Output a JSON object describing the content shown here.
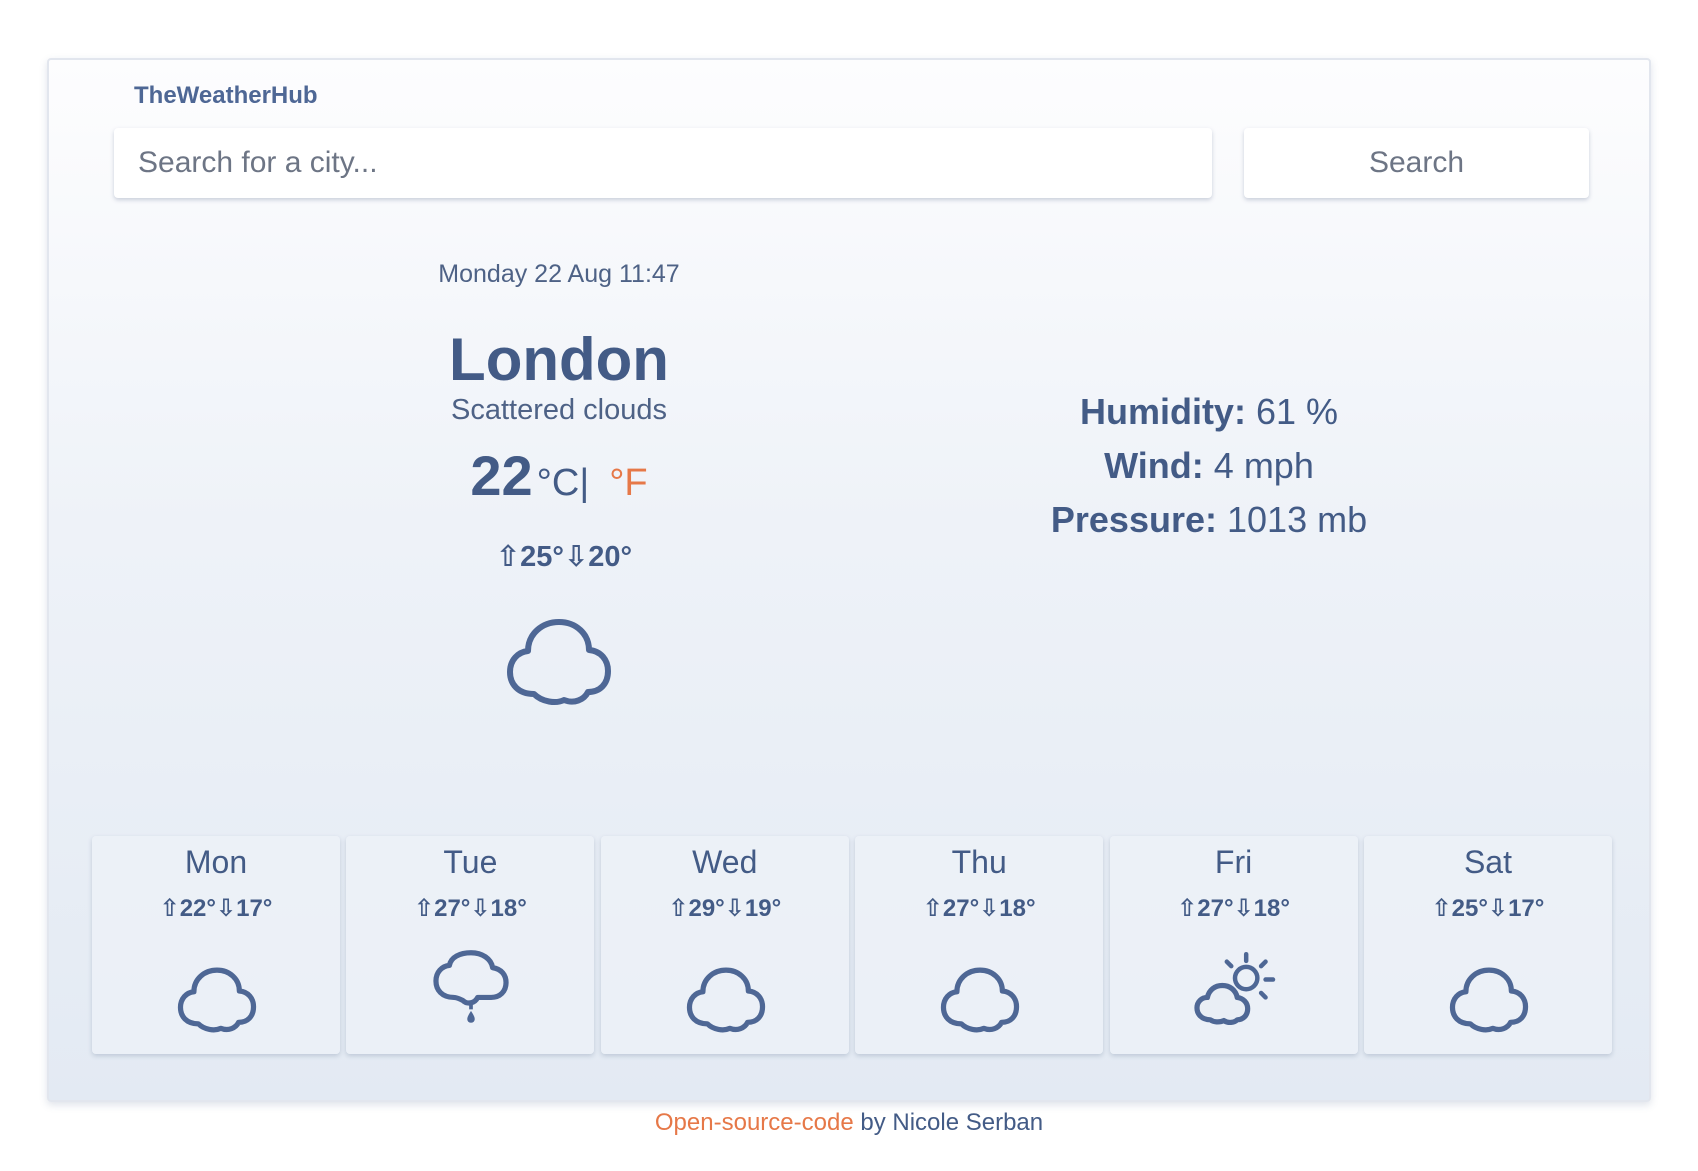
{
  "brand": "TheWeatherHub",
  "search": {
    "placeholder": "Search for a city...",
    "value": "",
    "button_label": "Search"
  },
  "current": {
    "date": "Monday 22 Aug 11:47",
    "city": "London",
    "description": "Scattered clouds",
    "temperature": "22",
    "unit_celsius": "°C",
    "unit_separator": "|",
    "unit_fahrenheit": "°F",
    "high": "⇧25°",
    "low": "⇩20°",
    "icon": "cloud-icon"
  },
  "details": {
    "humidity_label": "Humidity:",
    "humidity_value": "61 %",
    "wind_label": "Wind:",
    "wind_value": "4 mph",
    "pressure_label": "Pressure:",
    "pressure_value": "1013 mb"
  },
  "forecast": [
    {
      "day": "Mon",
      "high": "⇧22°",
      "low": "⇩17°",
      "icon": "cloud-icon"
    },
    {
      "day": "Tue",
      "high": "⇧27°",
      "low": "⇩18°",
      "icon": "rain-cloud-icon"
    },
    {
      "day": "Wed",
      "high": "⇧29°",
      "low": "⇩19°",
      "icon": "cloud-icon"
    },
    {
      "day": "Thu",
      "high": "⇧27°",
      "low": "⇩18°",
      "icon": "cloud-icon"
    },
    {
      "day": "Fri",
      "high": "⇧27°",
      "low": "⇩18°",
      "icon": "partly-sunny-icon"
    },
    {
      "day": "Sat",
      "high": "⇧25°",
      "low": "⇩17°",
      "icon": "cloud-icon"
    }
  ],
  "footer": {
    "link_text": "Open-source-code",
    "suffix": " by Nicole Serban"
  },
  "colors": {
    "primary": "#435b86",
    "accent": "#e67848",
    "icon_stroke": "#4e6795"
  }
}
